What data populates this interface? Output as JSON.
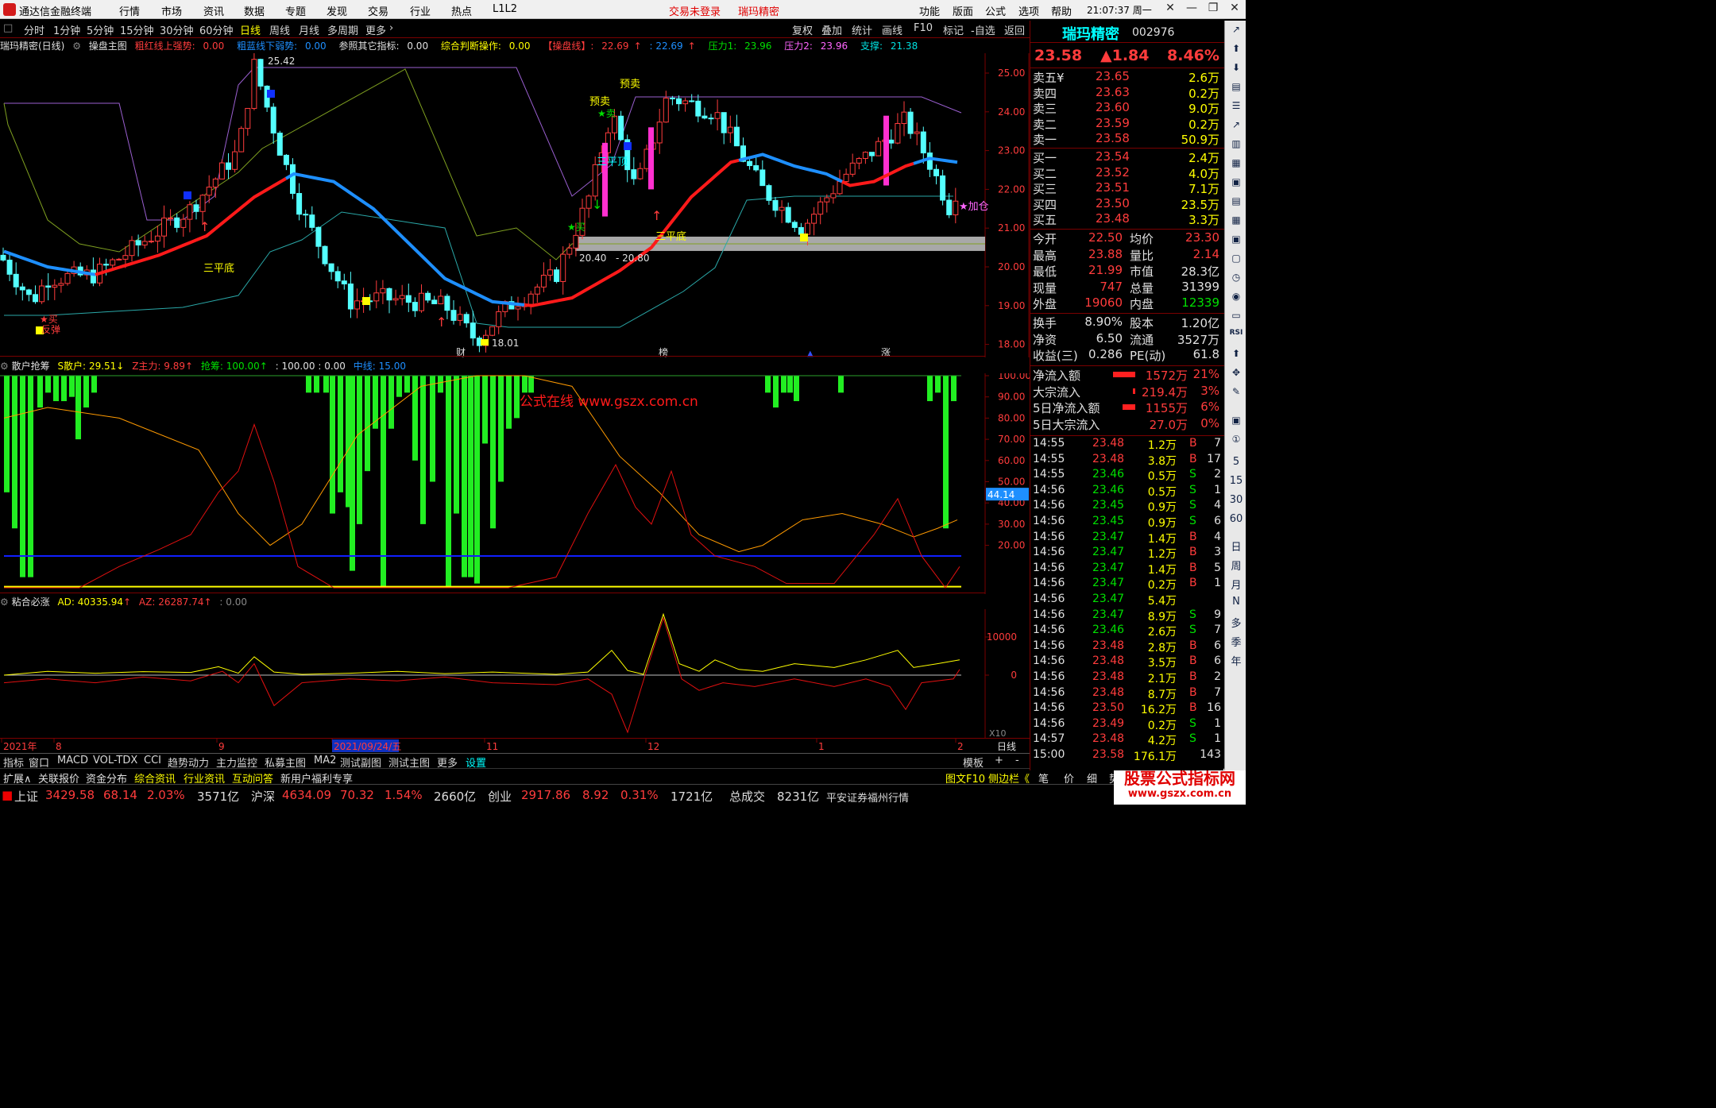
{
  "app": {
    "title": "通达信金融终端",
    "login": "交易未登录",
    "login_stock": "瑞玛精密",
    "time": "21:07:37 周一",
    "menus": [
      "行情",
      "市场",
      "资讯",
      "数据",
      "专题",
      "发现",
      "交易",
      "行业",
      "热点",
      "L1L2"
    ],
    "right_menus": [
      "功能",
      "版面",
      "公式",
      "选项",
      "帮助"
    ]
  },
  "toolbar": {
    "periods": [
      "分时",
      "1分钟",
      "5分钟",
      "15分钟",
      "30分钟",
      "60分钟",
      "日线",
      "周线",
      "月线",
      "多周期",
      "更多"
    ],
    "actions": [
      "复权",
      "叠加",
      "统计",
      "画线",
      "F10",
      "标记",
      "-自选",
      "返回"
    ]
  },
  "main_info": {
    "stock": "瑞玛精密(日线)",
    "formula": "操盘主图",
    "red_label": "粗红线上强势:",
    "red_val": "0.00",
    "blue_label": "粗蓝线下弱势:",
    "blue_val": "0.00",
    "ref_label": "参照其它指标:",
    "ref_val": "0.00",
    "judge_label": "综合判断操作:",
    "judge_val": "0.00",
    "line_label": "【操盘线】:",
    "line_val": "22.69",
    "line_val2": "22.69",
    "p1_label": "压力1:",
    "p1": "23.96",
    "p2_label": "压力2:",
    "p2": "23.96",
    "sup_label": "支撑:",
    "sup": "21.38"
  },
  "price_axis": [
    "25.00",
    "24.00",
    "23.00",
    "22.00",
    "21.00",
    "20.00",
    "19.00",
    "18.00"
  ],
  "annotations": {
    "high": "25.42",
    "low": "18.01",
    "range1": "20.40",
    "range2": "20.80",
    "sanpingdi1": "三平底",
    "sanpingdi2": "三平底",
    "sanpingdi3": "三平顶",
    "buy": "买",
    "buy2": "买",
    "sell": "卖",
    "fandan": "反弹",
    "yumai": "预卖",
    "jiacang": "加仓",
    "cai": "财",
    "bang": "榜",
    "zhang": "涨"
  },
  "sub1": {
    "name": "散户抢筹",
    "s_label": "S散户:",
    "s_val": "29.51",
    "z_label": "Z主力:",
    "z_val": "9.89",
    "q_label": "抢筹:",
    "q_val": "100.00",
    "v1": ": 100.00",
    "v2": ": 0.00",
    "mid_label": "中线:",
    "mid_val": "15.00",
    "axis": [
      "100.00",
      "90.00",
      "80.00",
      "70.00",
      "60.00",
      "50.00",
      "40.00",
      "30.00",
      "20.00"
    ],
    "marker": "44.14",
    "watermark": "公式在线  www.gszx.com.cn"
  },
  "sub2": {
    "name": "粘合必涨",
    "ad_label": "AD:",
    "ad_val": "40335.94",
    "az_label": "AZ:",
    "az_val": "26287.74",
    "v": ": 0.00",
    "axis": [
      "10000",
      "0"
    ],
    "x10": "X10"
  },
  "time_axis": {
    "labels": [
      "2021年",
      "8",
      "9",
      "2021/09/24/五",
      "11",
      "12",
      "1",
      "2"
    ],
    "right": "日线"
  },
  "tabs": [
    "指标",
    "窗口",
    "MACD",
    "VOL-TDX",
    "CCI",
    "趋势动力",
    "主力监控",
    "私募主图",
    "MA2",
    "测试副图",
    "测试主图",
    "更多",
    "设置"
  ],
  "tabs_right": [
    "模板",
    "+",
    "-"
  ],
  "tabs2": [
    "扩展∧",
    "关联报价",
    "资金分布",
    "综合资讯",
    "行业资讯",
    "互动问答",
    "新用户福利专享"
  ],
  "tabs2_right": [
    "图文F10",
    "侧边栏《",
    "笔",
    "价",
    "细",
    "势",
    "联",
    "值",
    "主"
  ],
  "quote": {
    "name": "瑞玛精密",
    "code": "002976",
    "price": "23.58",
    "change": "▲1.84",
    "pct": "8.46%",
    "sells": [
      {
        "l": "卖五",
        "s": "¥",
        "p": "23.65",
        "v": "2.6万"
      },
      {
        "l": "卖四",
        "s": "",
        "p": "23.63",
        "v": "0.2万"
      },
      {
        "l": "卖三",
        "s": "",
        "p": "23.60",
        "v": "9.0万"
      },
      {
        "l": "卖二",
        "s": "",
        "p": "23.59",
        "v": "0.2万"
      },
      {
        "l": "卖一",
        "s": "",
        "p": "23.58",
        "v": "50.9万"
      }
    ],
    "buys": [
      {
        "l": "买一",
        "p": "23.54",
        "v": "2.4万"
      },
      {
        "l": "买二",
        "p": "23.52",
        "v": "4.0万"
      },
      {
        "l": "买三",
        "p": "23.51",
        "v": "7.1万"
      },
      {
        "l": "买四",
        "p": "23.50",
        "v": "23.5万"
      },
      {
        "l": "买五",
        "p": "23.48",
        "v": "3.3万"
      }
    ],
    "stats": [
      {
        "a": "今开",
        "av": "22.50",
        "b": "均价",
        "bv": "23.30"
      },
      {
        "a": "最高",
        "av": "23.88",
        "b": "量比",
        "bv": "2.14"
      },
      {
        "a": "最低",
        "av": "21.99",
        "b": "市值",
        "bv": "28.3亿"
      },
      {
        "a": "现量",
        "av": "747",
        "b": "总量",
        "bv": "31399"
      },
      {
        "a": "外盘",
        "av": "19060",
        "b": "内盘",
        "bv": "12339"
      }
    ],
    "stats2": [
      {
        "a": "换手",
        "av": "8.90%",
        "b": "股本",
        "bv": "1.20亿"
      },
      {
        "a": "净资",
        "av": "6.50",
        "b": "流通",
        "bv": "3527万"
      },
      {
        "a": "收益(三)",
        "av": "0.286",
        "b": "PE(动)",
        "bv": "61.8"
      }
    ],
    "flows": [
      {
        "a": "净流入额",
        "v": "1572万",
        "p": "21%"
      },
      {
        "a": "大宗流入",
        "v": "219.4万",
        "p": "3%"
      },
      {
        "a": "5日净流入额",
        "v": "1155万",
        "p": "6%"
      },
      {
        "a": "5日大宗流入",
        "v": "27.0万",
        "p": "0%"
      }
    ],
    "ticks": [
      [
        "14:55",
        "23.48",
        "1.2万",
        "B",
        "7"
      ],
      [
        "14:55",
        "23.48",
        "3.8万",
        "B",
        "17"
      ],
      [
        "14:55",
        "23.46",
        "0.5万",
        "S",
        "2"
      ],
      [
        "14:56",
        "23.46",
        "0.5万",
        "S",
        "1"
      ],
      [
        "14:56",
        "23.45",
        "0.9万",
        "S",
        "4"
      ],
      [
        "14:56",
        "23.45",
        "0.9万",
        "S",
        "6"
      ],
      [
        "14:56",
        "23.47",
        "1.4万",
        "B",
        "4"
      ],
      [
        "14:56",
        "23.47",
        "1.2万",
        "B",
        "3"
      ],
      [
        "14:56",
        "23.47",
        "1.4万",
        "B",
        "5"
      ],
      [
        "14:56",
        "23.47",
        "0.2万",
        "B",
        "1"
      ],
      [
        "14:56",
        "23.47",
        "5.4万",
        "",
        ""
      ],
      [
        "14:56",
        "23.47",
        "8.9万",
        "S",
        "9"
      ],
      [
        "14:56",
        "23.46",
        "2.6万",
        "S",
        "7"
      ],
      [
        "14:56",
        "23.48",
        "2.8万",
        "B",
        "6"
      ],
      [
        "14:56",
        "23.48",
        "3.5万",
        "B",
        "6"
      ],
      [
        "14:56",
        "23.48",
        "2.1万",
        "B",
        "2"
      ],
      [
        "14:56",
        "23.48",
        "8.7万",
        "B",
        "7"
      ],
      [
        "14:56",
        "23.50",
        "16.2万",
        "B",
        "16"
      ],
      [
        "14:56",
        "23.49",
        "0.2万",
        "S",
        "1"
      ],
      [
        "14:57",
        "23.48",
        "4.2万",
        "S",
        "1"
      ],
      [
        "15:00",
        "23.58",
        "176.1万",
        "",
        "143"
      ]
    ]
  },
  "sidebar": {
    "nums": [
      "5",
      "15",
      "30",
      "60"
    ],
    "days": [
      "日",
      "周",
      "月",
      "N",
      "多",
      "季",
      "年"
    ]
  },
  "status": {
    "sh_label": "上证",
    "sh": "3429.58",
    "sh_chg": "68.14",
    "sh_pct": "2.03%",
    "sh_amt": "3571亿",
    "sz_label": "沪深",
    "sz": "4634.09",
    "sz_chg": "70.32",
    "sz_pct": "1.54%",
    "sz_amt": "2660亿",
    "cy_label": "创业",
    "cy": "2917.86",
    "cy_chg": "8.92",
    "cy_pct": "0.31%",
    "cy_amt": "1721亿",
    "total_label": "总成交",
    "total": "8231亿",
    "broker": "平安证券福州行情",
    "watermark": "股票公式指标网",
    "watermark_url": "www.gszx.com.cn"
  },
  "colors": {
    "up": "#ff3c3c",
    "down": "#00ffff",
    "ma_red": "#ff1a1a",
    "ma_blue": "#1e8fff",
    "bar_green": "#22ee22"
  }
}
